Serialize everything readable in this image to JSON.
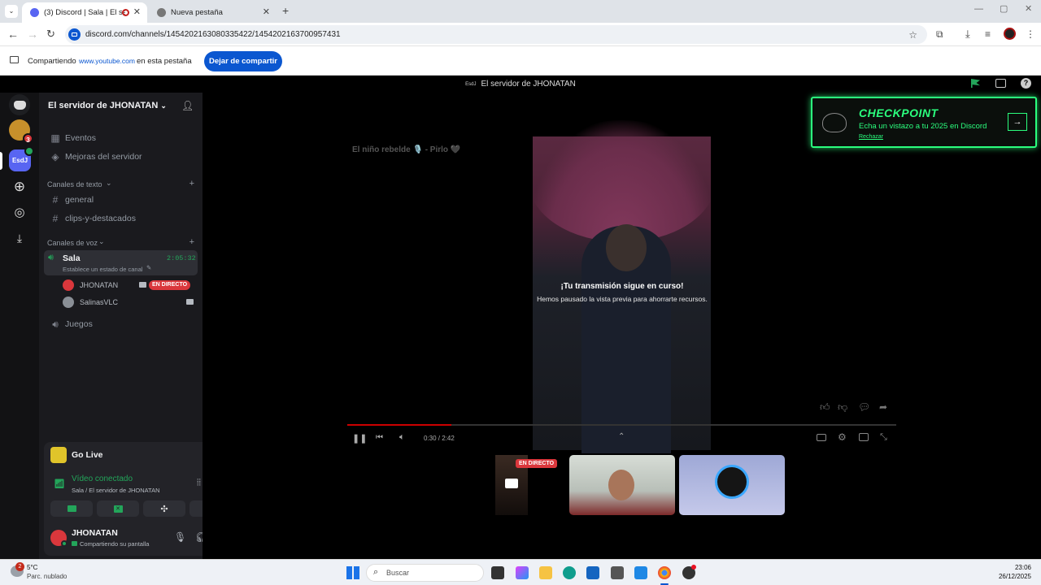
{
  "browser": {
    "tabs": [
      {
        "title": "(3) Discord | Sala | El servidor",
        "active": true
      },
      {
        "title": "Nueva pestaña",
        "active": false
      }
    ],
    "url": "discord.com/channels/1454202163080335422/1454202163700957431",
    "share_bar": {
      "prefix": "Compartiendo",
      "site": "www.youtube.com",
      "suffix": "en esta pestaña",
      "stop_button": "Dejar de compartir"
    }
  },
  "discord": {
    "window_title": "El servidor de JHONATAN",
    "server_badge": "EsdJ",
    "server_name": "El servidor de JHONATAN",
    "guild_badge_count": "3",
    "top_items": [
      "Eventos",
      "Mejoras del servidor"
    ],
    "text_category": "Canales de texto",
    "text_channels": [
      "general",
      "clips-y-destacados"
    ],
    "voice_category": "Canales de voz",
    "voice_channel": {
      "name": "Sala",
      "timer": "2:05:32",
      "status_hint": "Establece un estado de canal",
      "members": [
        {
          "name": "JHONATAN",
          "live_badge": "EN DIRECTO"
        },
        {
          "name": "SalinasVLC"
        }
      ]
    },
    "other_voice": "Juegos",
    "go_live": "Go Live",
    "connection": {
      "status": "Vídeo conectado",
      "location": "Sala / El servidor de JHONATAN"
    },
    "user": {
      "name": "JHONATAN",
      "status": "Compartiendo su pantalla"
    },
    "checkpoint": {
      "title": "CHECKPOINT",
      "subtitle": "Echa un vistazo a tu 2025 en Discord",
      "dismiss": "Rechazar"
    },
    "stream": {
      "video_title": "El niño rebelde 🎙️ - Pirlo 🖤",
      "paused_title": "¡Tu transmisión sigue en curso!",
      "paused_message": "Hemos pausado la vista previa para ahorrarte recursos.",
      "time": "0:30 / 2:42",
      "progress": 0.19
    },
    "tile_live_badge": "EN DIRECTO"
  },
  "taskbar": {
    "weather_temp": "5°C",
    "weather_desc": "Parc. nublado",
    "weather_badge": "2",
    "search_placeholder": "Buscar",
    "time": "23:06",
    "date": "26/12/2025"
  },
  "colors": {
    "discord_green": "#23a55a",
    "live_red": "#da373c",
    "blurple": "#5865f2",
    "checkpoint_green": "#2bff7e",
    "chrome_blue": "#0b57d0"
  }
}
